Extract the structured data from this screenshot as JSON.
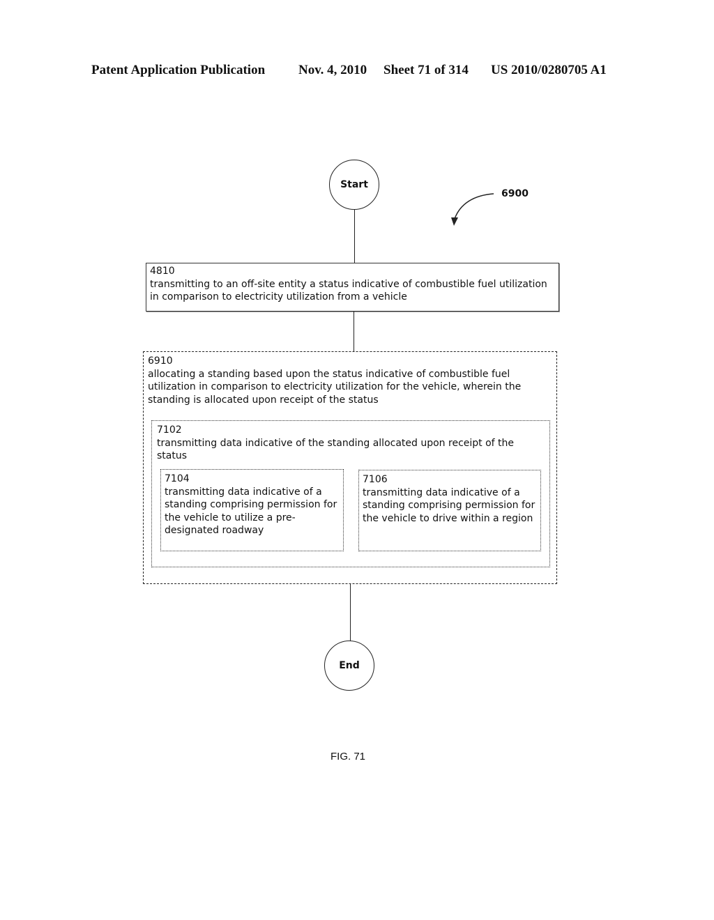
{
  "header": {
    "publication": "Patent Application Publication",
    "date": "Nov. 4, 2010",
    "sheet": "Sheet 71 of 314",
    "patent_number": "US 2010/0280705 A1"
  },
  "diagram": {
    "reference_label": "6900",
    "start_label": "Start",
    "end_label": "End",
    "steps": [
      {
        "id": "4810",
        "text": "transmitting to an off-site entity a status indicative of combustible fuel utilization in comparison to electricity utilization from a vehicle",
        "border": "solid"
      },
      {
        "id": "6910",
        "text": "allocating a standing based upon the status indicative of combustible fuel utilization in comparison to electricity utilization for the vehicle, wherein the standing is allocated upon receipt of the status",
        "border": "dashed",
        "children": [
          {
            "id": "7102",
            "text": "transmitting data indicative of the standing allocated upon receipt of the status",
            "border": "dotted",
            "children": [
              {
                "id": "7104",
                "text": "transmitting data indicative of a standing comprising permission for the vehicle to utilize a pre-designated roadway",
                "border": "dotted"
              },
              {
                "id": "7106",
                "text": "transmitting data indicative of a standing comprising permission for the vehicle to drive within a region",
                "border": "dotted"
              }
            ]
          }
        ]
      }
    ]
  },
  "figure_caption": "FIG. 71"
}
